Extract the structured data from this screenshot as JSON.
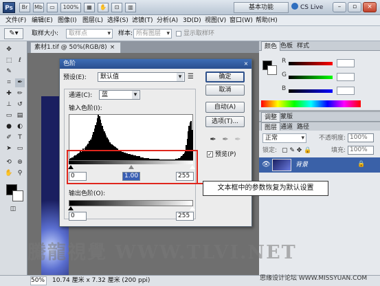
{
  "app": {
    "logo": "Ps",
    "workspace": "基本功能",
    "cs_live": "CS Live"
  },
  "title_icons": [
    "Br",
    "Mb",
    "▭",
    "100%",
    "▦",
    "✋",
    "⊡",
    "▥"
  ],
  "menu": [
    "文件(F)",
    "编辑(E)",
    "图像(I)",
    "图层(L)",
    "选择(S)",
    "滤镜(T)",
    "分析(A)",
    "3D(D)",
    "视图(V)",
    "窗口(W)",
    "帮助(H)"
  ],
  "options": {
    "sample_size_label": "取样大小:",
    "sample_size_value": "取样点",
    "sample_label": "样本:",
    "sample_value": "所有图层",
    "show_ring_label": "显示取样环"
  },
  "document": {
    "tab_title": "素材1.tif @ 50%(RGB/8)"
  },
  "status": {
    "zoom": "50%",
    "info": "10.74 厘米 x 7.32 厘米 (200 ppi)"
  },
  "panels": {
    "color_tabs": [
      "颜色",
      "色板",
      "样式"
    ],
    "channels": [
      "R",
      "G",
      "B"
    ],
    "adjust_tabs": [
      "调整",
      "蒙版"
    ],
    "layer_tabs": [
      "图层",
      "通道",
      "路径"
    ],
    "blend_mode": "正常",
    "opacity_label": "不透明度:",
    "opacity_value": "100%",
    "lock_label": "锁定:",
    "fill_label": "填充:",
    "fill_value": "100%",
    "layer_name": "背景"
  },
  "dialog": {
    "title": "色阶",
    "preset_label": "预设(E):",
    "preset_value": "默认值",
    "channel_label": "通道(C):",
    "channel_value": "蓝",
    "input_levels_label": "输入色阶(I):",
    "input_black": "0",
    "input_gamma": "1.00",
    "input_white": "255",
    "output_levels_label": "输出色阶(O):",
    "output_black": "0",
    "output_white": "255",
    "ok": "确定",
    "cancel": "取消",
    "auto": "自动(A)",
    "options": "选项(T)...",
    "preview": "预览(P)",
    "preview_checked": true
  },
  "histogram_values": [
    2,
    3,
    4,
    4,
    5,
    6,
    6,
    7,
    8,
    9,
    10,
    12,
    11,
    13,
    15,
    14,
    16,
    18,
    20,
    22,
    25,
    24,
    27,
    30,
    34,
    37,
    42,
    46,
    50,
    55,
    60,
    58,
    54,
    49,
    45,
    41,
    38,
    35,
    33,
    30,
    28,
    26,
    24,
    22,
    21,
    20,
    19,
    18,
    17,
    16,
    15,
    14,
    13,
    12,
    12,
    11,
    11,
    10,
    10,
    9,
    9,
    8,
    8,
    8,
    7,
    7,
    7,
    6,
    6,
    6,
    5,
    5,
    5,
    5,
    4,
    4,
    4,
    4,
    3,
    3,
    3,
    3,
    3,
    3,
    2,
    2,
    2,
    2,
    2,
    2,
    2,
    2,
    2,
    2,
    2,
    1,
    1,
    1,
    1,
    1,
    1,
    1,
    1,
    1,
    1,
    1,
    1,
    1,
    1,
    1,
    1,
    1,
    2,
    2,
    2,
    3,
    3,
    4,
    5,
    6,
    8,
    10,
    14,
    20,
    28,
    38,
    45,
    50,
    52,
    40
  ],
  "annotation": "文本框中的参数恢复为默认设置",
  "watermark": "騰龍視覺 WWW.TLVI.NET",
  "watermark2": "思缘设计论坛 WWW.MISSYUAN.COM"
}
